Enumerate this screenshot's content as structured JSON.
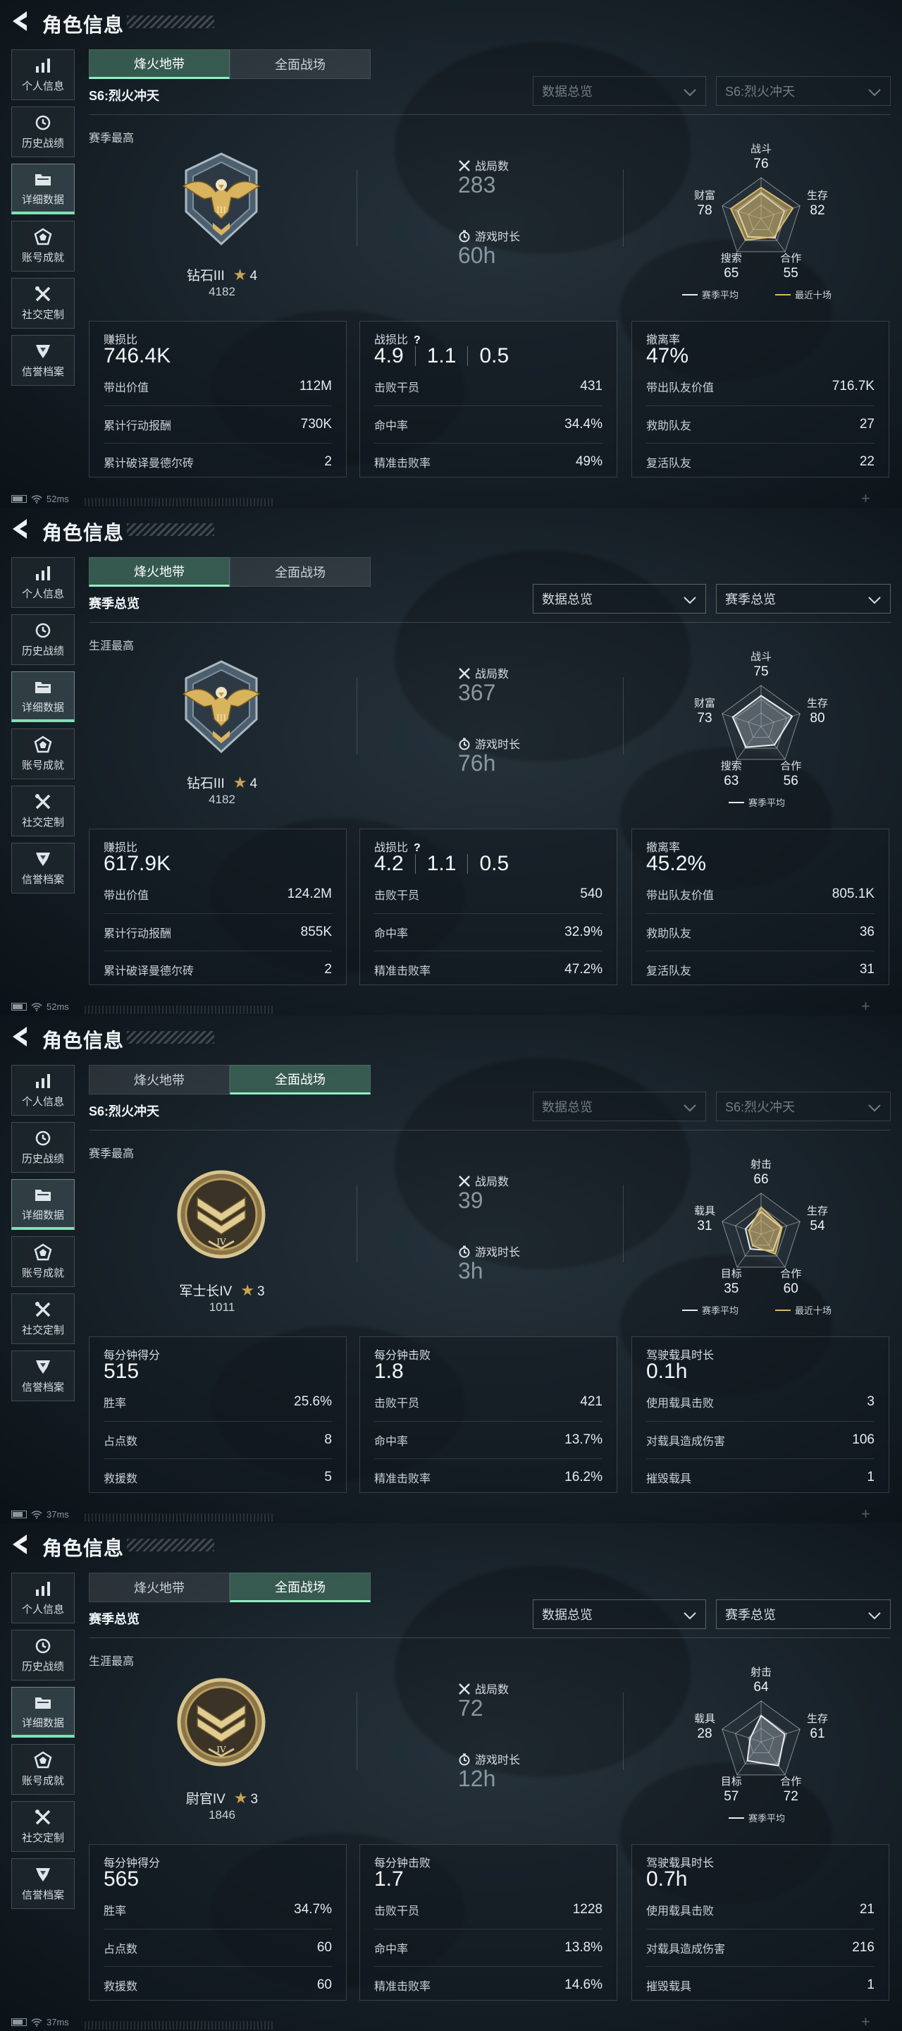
{
  "colors": {
    "accent": "#8ff0c2",
    "gold": "#c9a254",
    "season_line": "#e8ecee",
    "recent_line": "#d8b86a"
  },
  "panels": [
    {
      "title": "角色信息",
      "nav": [
        {
          "label": "个人信息",
          "icon": "bar-chart-icon",
          "active": false
        },
        {
          "label": "历史战绩",
          "icon": "clock-history-icon",
          "active": false
        },
        {
          "label": "详细数据",
          "icon": "folder-icon",
          "active": true
        },
        {
          "label": "账号成就",
          "icon": "achievement-icon",
          "active": false
        },
        {
          "label": "社交定制",
          "icon": "tools-icon",
          "active": false
        },
        {
          "label": "信誉档案",
          "icon": "shield-icon",
          "active": false
        }
      ],
      "tabs": [
        {
          "label": "烽火地带",
          "active": true
        },
        {
          "label": "全面战场",
          "active": false
        }
      ],
      "season_label": "S6:烈火冲天",
      "dropdowns": [
        {
          "label": "数据总览",
          "dim": true
        },
        {
          "label": "S6:烈火冲天",
          "dim": true
        }
      ],
      "high_label": "赛季最高",
      "badge_icon": "eagle-badge-icon",
      "rank": {
        "name": "钻石III",
        "stars": "4",
        "points": "4182"
      },
      "mid": {
        "matches_label": "战局数",
        "matches": "283",
        "time_label": "游戏时长",
        "time": "60h"
      },
      "radar": {
        "axes": [
          {
            "label": "战斗",
            "value": "76"
          },
          {
            "label": "生存",
            "value": "82"
          },
          {
            "label": "合作",
            "value": "55"
          },
          {
            "label": "搜索",
            "value": "65"
          },
          {
            "label": "财富",
            "value": "78"
          }
        ],
        "values": [
          76,
          82,
          55,
          65,
          78
        ],
        "compare": [
          62,
          60,
          58,
          55,
          60
        ],
        "max": 100,
        "legend": [
          {
            "label": "赛季平均",
            "type": "season"
          },
          {
            "label": "最近十场",
            "type": "recent"
          }
        ]
      },
      "cards": [
        {
          "title": "赚损比",
          "big": "746.4K",
          "rows": [
            {
              "label": "带出价值",
              "value": "112M"
            },
            {
              "label": "累计行动报酬",
              "value": "730K"
            },
            {
              "label": "累计破译曼德尔砖",
              "value": "2"
            }
          ]
        },
        {
          "title": "战损比",
          "help": "?",
          "big_parts": [
            "4.9",
            "1.1",
            "0.5"
          ],
          "rows": [
            {
              "label": "击败干员",
              "value": "431"
            },
            {
              "label": "命中率",
              "value": "34.4%"
            },
            {
              "label": "精准击败率",
              "value": "49%"
            }
          ]
        },
        {
          "title": "撤离率",
          "big": "47%",
          "rows": [
            {
              "label": "带出队友价值",
              "value": "716.7K"
            },
            {
              "label": "救助队友",
              "value": "27"
            },
            {
              "label": "复活队友",
              "value": "22"
            }
          ]
        }
      ],
      "status": {
        "ping": "52ms"
      }
    },
    {
      "title": "角色信息",
      "nav": [
        {
          "label": "个人信息",
          "icon": "bar-chart-icon",
          "active": false
        },
        {
          "label": "历史战绩",
          "icon": "clock-history-icon",
          "active": false
        },
        {
          "label": "详细数据",
          "icon": "folder-icon",
          "active": true
        },
        {
          "label": "账号成就",
          "icon": "achievement-icon",
          "active": false
        },
        {
          "label": "社交定制",
          "icon": "tools-icon",
          "active": false
        },
        {
          "label": "信誉档案",
          "icon": "shield-icon",
          "active": false
        }
      ],
      "tabs": [
        {
          "label": "烽火地带",
          "active": true
        },
        {
          "label": "全面战场",
          "active": false
        }
      ],
      "season_label": "赛季总览",
      "dropdowns": [
        {
          "label": "数据总览",
          "dim": false
        },
        {
          "label": "赛季总览",
          "dim": false
        }
      ],
      "high_label": "生涯最高",
      "badge_icon": "eagle-badge-icon",
      "rank": {
        "name": "钻石III",
        "stars": "4",
        "points": "4182"
      },
      "mid": {
        "matches_label": "战局数",
        "matches": "367",
        "time_label": "游戏时长",
        "time": "76h"
      },
      "radar": {
        "axes": [
          {
            "label": "战斗",
            "value": "75"
          },
          {
            "label": "生存",
            "value": "80"
          },
          {
            "label": "合作",
            "value": "56"
          },
          {
            "label": "搜索",
            "value": "63"
          },
          {
            "label": "财富",
            "value": "73"
          }
        ],
        "values": [
          75,
          80,
          56,
          63,
          73
        ],
        "compare": null,
        "max": 100,
        "legend": [
          {
            "label": "赛季平均",
            "type": "season"
          }
        ]
      },
      "cards": [
        {
          "title": "赚损比",
          "big": "617.9K",
          "rows": [
            {
              "label": "带出价值",
              "value": "124.2M"
            },
            {
              "label": "累计行动报酬",
              "value": "855K"
            },
            {
              "label": "累计破译曼德尔砖",
              "value": "2"
            }
          ]
        },
        {
          "title": "战损比",
          "help": "?",
          "big_parts": [
            "4.2",
            "1.1",
            "0.5"
          ],
          "rows": [
            {
              "label": "击败干员",
              "value": "540"
            },
            {
              "label": "命中率",
              "value": "32.9%"
            },
            {
              "label": "精准击败率",
              "value": "47.2%"
            }
          ]
        },
        {
          "title": "撤离率",
          "big": "45.2%",
          "rows": [
            {
              "label": "带出队友价值",
              "value": "805.1K"
            },
            {
              "label": "救助队友",
              "value": "36"
            },
            {
              "label": "复活队友",
              "value": "31"
            }
          ]
        }
      ],
      "status": {
        "ping": "52ms"
      }
    },
    {
      "title": "角色信息",
      "nav": [
        {
          "label": "个人信息",
          "icon": "bar-chart-icon",
          "active": false
        },
        {
          "label": "历史战绩",
          "icon": "clock-history-icon",
          "active": false
        },
        {
          "label": "详细数据",
          "icon": "folder-icon",
          "active": true
        },
        {
          "label": "账号成就",
          "icon": "achievement-icon",
          "active": false
        },
        {
          "label": "社交定制",
          "icon": "tools-icon",
          "active": false
        },
        {
          "label": "信誉档案",
          "icon": "shield-icon",
          "active": false
        }
      ],
      "tabs": [
        {
          "label": "烽火地带",
          "active": false
        },
        {
          "label": "全面战场",
          "active": true
        }
      ],
      "season_label": "S6:烈火冲天",
      "dropdowns": [
        {
          "label": "数据总览",
          "dim": true
        },
        {
          "label": "S6:烈火冲天",
          "dim": true
        }
      ],
      "high_label": "赛季最高",
      "badge_icon": "chevron-rank-badge-icon",
      "rank": {
        "name": "军士长IV",
        "stars": "3",
        "points": "1011"
      },
      "mid": {
        "matches_label": "战局数",
        "matches": "39",
        "time_label": "游戏时长",
        "time": "3h"
      },
      "radar": {
        "axes": [
          {
            "label": "射击",
            "value": "66"
          },
          {
            "label": "生存",
            "value": "54"
          },
          {
            "label": "合作",
            "value": "60"
          },
          {
            "label": "目标",
            "value": "35"
          },
          {
            "label": "载具",
            "value": "31"
          }
        ],
        "values": [
          66,
          54,
          60,
          35,
          31
        ],
        "compare": [
          55,
          52,
          50,
          45,
          40
        ],
        "max": 100,
        "legend": [
          {
            "label": "赛季平均",
            "type": "season"
          },
          {
            "label": "最近十场",
            "type": "recent"
          }
        ]
      },
      "cards": [
        {
          "title": "每分钟得分",
          "big": "515",
          "rows": [
            {
              "label": "胜率",
              "value": "25.6%"
            },
            {
              "label": "占点数",
              "value": "8"
            },
            {
              "label": "救援数",
              "value": "5"
            }
          ]
        },
        {
          "title": "每分钟击败",
          "big": "1.8",
          "rows": [
            {
              "label": "击败干员",
              "value": "421"
            },
            {
              "label": "命中率",
              "value": "13.7%"
            },
            {
              "label": "精准击败率",
              "value": "16.2%"
            }
          ]
        },
        {
          "title": "驾驶载具时长",
          "big": "0.1h",
          "rows": [
            {
              "label": "使用载具击败",
              "value": "3"
            },
            {
              "label": "对载具造成伤害",
              "value": "106"
            },
            {
              "label": "摧毁载具",
              "value": "1"
            }
          ]
        }
      ],
      "status": {
        "ping": "37ms"
      }
    },
    {
      "title": "角色信息",
      "nav": [
        {
          "label": "个人信息",
          "icon": "bar-chart-icon",
          "active": false
        },
        {
          "label": "历史战绩",
          "icon": "clock-history-icon",
          "active": false
        },
        {
          "label": "详细数据",
          "icon": "folder-icon",
          "active": true
        },
        {
          "label": "账号成就",
          "icon": "achievement-icon",
          "active": false
        },
        {
          "label": "社交定制",
          "icon": "tools-icon",
          "active": false
        },
        {
          "label": "信誉档案",
          "icon": "shield-icon",
          "active": false
        }
      ],
      "tabs": [
        {
          "label": "烽火地带",
          "active": false
        },
        {
          "label": "全面战场",
          "active": true
        }
      ],
      "season_label": "赛季总览",
      "dropdowns": [
        {
          "label": "数据总览",
          "dim": false
        },
        {
          "label": "赛季总览",
          "dim": false
        }
      ],
      "high_label": "生涯最高",
      "badge_icon": "chevron-rank-badge-icon",
      "rank": {
        "name": "尉官IV",
        "stars": "3",
        "points": "1846"
      },
      "mid": {
        "matches_label": "战局数",
        "matches": "72",
        "time_label": "游戏时长",
        "time": "12h"
      },
      "radar": {
        "axes": [
          {
            "label": "射击",
            "value": "64"
          },
          {
            "label": "生存",
            "value": "61"
          },
          {
            "label": "合作",
            "value": "72"
          },
          {
            "label": "目标",
            "value": "57"
          },
          {
            "label": "载具",
            "value": "28"
          }
        ],
        "values": [
          64,
          61,
          72,
          57,
          28
        ],
        "compare": null,
        "max": 100,
        "legend": [
          {
            "label": "赛季平均",
            "type": "season"
          }
        ]
      },
      "cards": [
        {
          "title": "每分钟得分",
          "big": "565",
          "rows": [
            {
              "label": "胜率",
              "value": "34.7%"
            },
            {
              "label": "占点数",
              "value": "60"
            },
            {
              "label": "救援数",
              "value": "60"
            }
          ]
        },
        {
          "title": "每分钟击败",
          "big": "1.7",
          "rows": [
            {
              "label": "击败干员",
              "value": "1228"
            },
            {
              "label": "命中率",
              "value": "13.8%"
            },
            {
              "label": "精准击败率",
              "value": "14.6%"
            }
          ]
        },
        {
          "title": "驾驶载具时长",
          "big": "0.7h",
          "rows": [
            {
              "label": "使用载具击败",
              "value": "21"
            },
            {
              "label": "对载具造成伤害",
              "value": "216"
            },
            {
              "label": "摧毁载具",
              "value": "1"
            }
          ]
        }
      ],
      "status": {
        "ping": "37ms"
      }
    }
  ]
}
